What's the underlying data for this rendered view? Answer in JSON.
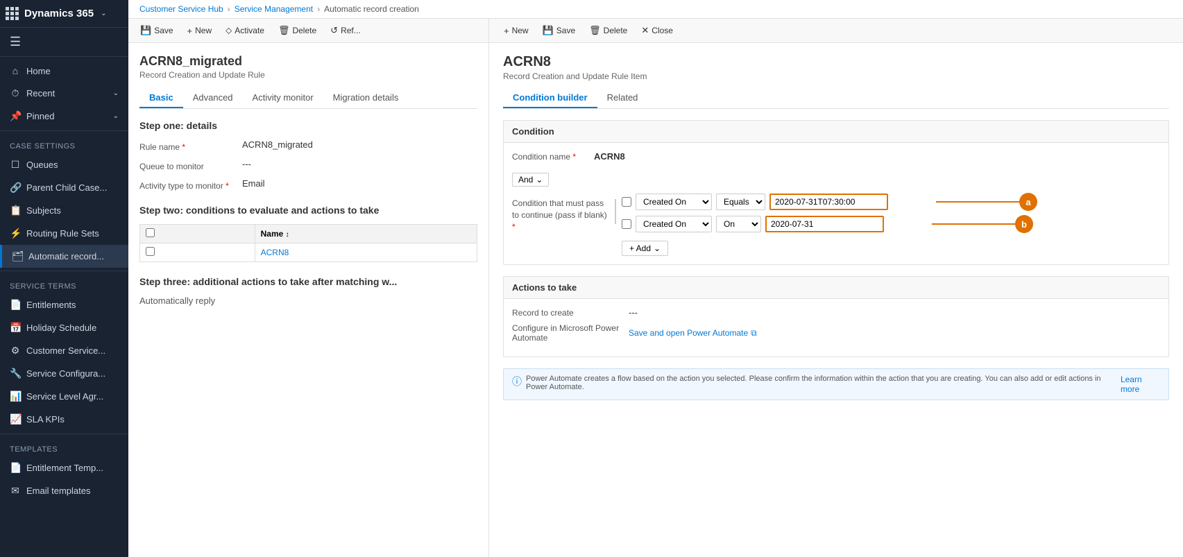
{
  "sidebar": {
    "app_name": "Dynamics 365",
    "nav_items": [
      {
        "id": "home",
        "label": "Home",
        "icon": "⌂"
      },
      {
        "id": "recent",
        "label": "Recent",
        "icon": "⏱",
        "has_chevron": true
      },
      {
        "id": "pinned",
        "label": "Pinned",
        "icon": "📌",
        "has_chevron": true
      }
    ],
    "case_settings_title": "Case Settings",
    "case_settings_items": [
      {
        "id": "queues",
        "label": "Queues",
        "icon": "☐"
      },
      {
        "id": "parent-child",
        "label": "Parent Child Case...",
        "icon": "🔗"
      },
      {
        "id": "subjects",
        "label": "Subjects",
        "icon": "📋"
      },
      {
        "id": "routing-rule-sets",
        "label": "Routing Rule Sets",
        "icon": "⚡",
        "active": false
      },
      {
        "id": "automatic-record",
        "label": "Automatic record...",
        "icon": "🗂",
        "active": true
      }
    ],
    "service_terms_title": "Service Terms",
    "service_terms_items": [
      {
        "id": "entitlements",
        "label": "Entitlements",
        "icon": "📄"
      },
      {
        "id": "holiday-schedule",
        "label": "Holiday Schedule",
        "icon": "📅"
      },
      {
        "id": "customer-service",
        "label": "Customer Service...",
        "icon": "⚙"
      },
      {
        "id": "service-configura",
        "label": "Service Configura...",
        "icon": "🔧"
      },
      {
        "id": "service-level-agr",
        "label": "Service Level Agr...",
        "icon": "📊"
      },
      {
        "id": "sla-kpis",
        "label": "SLA KPIs",
        "icon": "📈"
      }
    ],
    "templates_title": "Templates",
    "templates_items": [
      {
        "id": "entitlement-temp",
        "label": "Entitlement Temp...",
        "icon": "📄"
      },
      {
        "id": "email-templates",
        "label": "Email templates",
        "icon": "✉"
      }
    ]
  },
  "breadcrumb": {
    "parts": [
      "Customer Service Hub",
      "Service Management",
      "Automatic record creation"
    ]
  },
  "left_pane": {
    "toolbar": {
      "save_label": "Save",
      "new_label": "New",
      "activate_label": "Activate",
      "delete_label": "Delete",
      "refresh_label": "Ref..."
    },
    "record": {
      "title": "ACRN8_migrated",
      "subtitle": "Record Creation and Update Rule"
    },
    "tabs": [
      {
        "id": "basic",
        "label": "Basic",
        "active": true
      },
      {
        "id": "advanced",
        "label": "Advanced"
      },
      {
        "id": "activity-monitor",
        "label": "Activity monitor"
      },
      {
        "id": "migration-details",
        "label": "Migration details"
      }
    ],
    "step1": {
      "title": "Step one: details",
      "rule_name_label": "Rule name",
      "rule_name_value": "ACRN8_migrated",
      "queue_label": "Queue to monitor",
      "queue_value": "---",
      "activity_type_label": "Activity type to monitor",
      "activity_type_value": "Email"
    },
    "step2": {
      "title": "Step two: conditions to evaluate and actions to take",
      "table_header_name": "Name",
      "table_row": "ACRN8",
      "checkbox_label": "✓"
    },
    "step3": {
      "title": "Step three: additional actions to take after matching w...",
      "detail": "Automatically reply"
    }
  },
  "right_pane": {
    "toolbar": {
      "new_label": "New",
      "save_label": "Save",
      "delete_label": "Delete",
      "close_label": "Close"
    },
    "record": {
      "title": "ACRN8",
      "subtitle": "Record Creation and Update Rule Item"
    },
    "tabs": [
      {
        "id": "condition-builder",
        "label": "Condition builder",
        "active": true
      },
      {
        "id": "related",
        "label": "Related"
      }
    ],
    "condition_section": {
      "header": "Condition",
      "name_label": "Condition name",
      "name_value": "ACRN8",
      "and_label": "And",
      "condition_label": "Condition that must pass to continue (pass if blank)",
      "conditions": [
        {
          "id": "cond1",
          "field": "Created On",
          "operator": "Equals",
          "value": "2020-07-31T07:30:00",
          "callout": "a"
        },
        {
          "id": "cond2",
          "field": "Created On",
          "operator": "On",
          "value": "2020-07-31",
          "callout": "b"
        }
      ],
      "add_label": "+ Add"
    },
    "actions_section": {
      "header": "Actions to take",
      "record_label": "Record to create",
      "record_value": "---",
      "configure_label": "Configure in Microsoft Power Automate",
      "configure_link": "Save and open Power Automate",
      "configure_icon": "⧉"
    },
    "info_bar": {
      "text": "Power Automate creates a flow based on the action you selected. Please confirm the information within the action that you are creating. You can also add or edit actions in Power Automate.",
      "link_text": "Learn more"
    }
  }
}
